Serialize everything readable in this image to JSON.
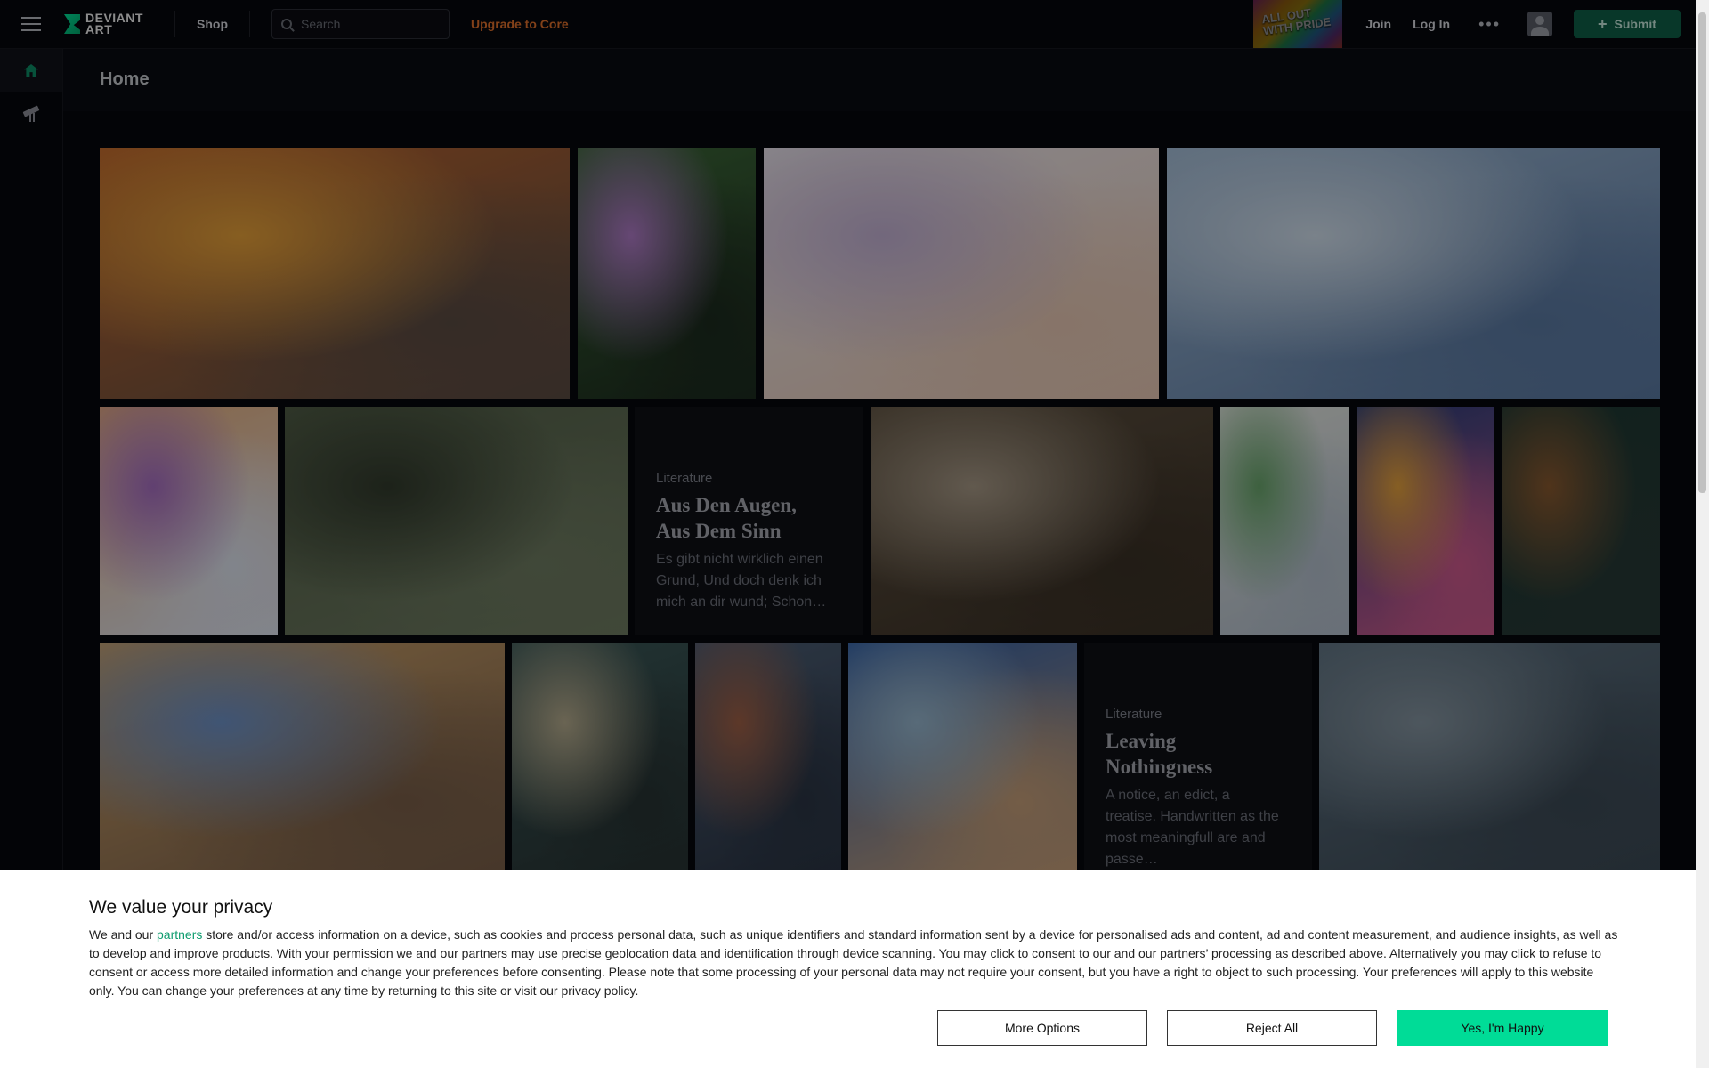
{
  "header": {
    "logo_line1": "DEVIANT",
    "logo_line2": "ART",
    "shop": "Shop",
    "search_placeholder": "Search",
    "upgrade": "Upgrade to Core",
    "promo_line1": "ALL OUT",
    "promo_line2": "WITH PRIDE",
    "join": "Join",
    "login": "Log In",
    "more": "•••",
    "submit": "Submit",
    "submit_icon": "+"
  },
  "sidebar": {
    "items": [
      {
        "icon": "home-icon"
      },
      {
        "icon": "telescope-icon"
      }
    ]
  },
  "main": {
    "title": "Home"
  },
  "feed": {
    "literature_1": {
      "category": "Literature",
      "title": "Aus Den Augen, Aus Dem Sinn",
      "excerpt": "Es gibt nicht wirklich einen Grund, Und doch denk ich mich an dir wund; Schon…"
    },
    "literature_2": {
      "category": "Literature",
      "title": "Leaving Nothingness",
      "excerpt": "A notice, an edict, a treatise. Handwritten as the most meaningfull are and passe…"
    },
    "artworks": [
      {
        "subject": "fire-dragon-warrior",
        "colors": [
          "#c2662d",
          "#e8a23a",
          "#5b4c43"
        ]
      },
      {
        "subject": "rainbow-rose",
        "colors": [
          "#3d6a39",
          "#b07bc8",
          "#1c2b1e"
        ]
      },
      {
        "subject": "rainbow-hair-runner",
        "colors": [
          "#eeeaf0",
          "#c5b3d6",
          "#e8c9b5"
        ]
      },
      {
        "subject": "city-race-track",
        "colors": [
          "#9fbad6",
          "#d2e0ee",
          "#5b7aa3"
        ]
      },
      {
        "subject": "fox-girl-flowers",
        "colors": [
          "#e8b07e",
          "#a76fc3",
          "#dfe4f0"
        ]
      },
      {
        "subject": "forest",
        "colors": [
          "#55624a",
          "#323b2d",
          "#6f7c62"
        ]
      },
      {
        "subject": "princess-mononoke-cosplay",
        "colors": [
          "#5e5140",
          "#a89a87",
          "#3b3126"
        ]
      },
      {
        "subject": "monster-claws-sheet",
        "colors": [
          "#e7eae5",
          "#6aa76d",
          "#b5c1ce"
        ]
      },
      {
        "subject": "lion-tiger-poster",
        "colors": [
          "#2a3f7c",
          "#e7a33e",
          "#d05b8e"
        ]
      },
      {
        "subject": "tree-roots",
        "colors": [
          "#1f3a35",
          "#8a5a30",
          "#273a36"
        ]
      },
      {
        "subject": "furiosa-truck",
        "colors": [
          "#cfa46b",
          "#6e93c8",
          "#7a5f49"
        ]
      },
      {
        "subject": "elf-warrior",
        "colors": [
          "#3b5a5a",
          "#b7ad8f",
          "#283434"
        ]
      },
      {
        "subject": "redhead-portrait",
        "colors": [
          "#4d5f76",
          "#a06147",
          "#2b3545"
        ]
      },
      {
        "subject": "floral-elephant",
        "colors": [
          "#2f5ea6",
          "#98b8d0",
          "#c7a07a"
        ]
      },
      {
        "subject": "seascape",
        "colors": [
          "#5e7282",
          "#8696a2",
          "#3c4a56"
        ]
      }
    ]
  },
  "consent": {
    "heading": "We value your privacy",
    "text_before_link": "We and our ",
    "link": "partners",
    "text_after_link": " store and/or access information on a device, such as cookies and process personal data, such as unique identifiers and standard information sent by a device for personalised ads and content, ad and content measurement, and audience insights, as well as to develop and improve products. With your permission we and our partners may use precise geolocation data and identification through device scanning. You may click to consent to our and our partners’ processing as described above. Alternatively you may click to refuse to consent or access more detailed information and change your preferences before consenting. Please note that some processing of your personal data may not require your consent, but you have a right to object to such processing. Your preferences will apply to this website only. You can change your preferences at any time by returning to this site or visit our privacy policy.",
    "more_options": "More Options",
    "reject_all": "Reject All",
    "accept": "Yes, I'm Happy"
  }
}
